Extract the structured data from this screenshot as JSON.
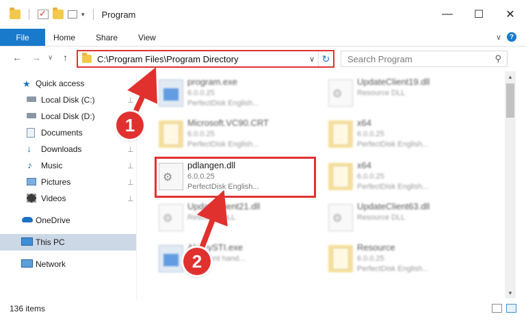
{
  "window": {
    "title": "Program",
    "minimize": "—",
    "maximize": "☐",
    "close": "✕"
  },
  "ribbon": {
    "tabs": [
      "File",
      "Home",
      "Share",
      "View"
    ],
    "expand": "∨",
    "help": "?"
  },
  "nav": {
    "back": "←",
    "forward": "→",
    "recent": "∨",
    "up": "↑",
    "address": "C:\\Program Files\\Program Directory",
    "address_dropdown": "∨",
    "refresh": "↻",
    "search_placeholder": "Search Program"
  },
  "sidebar": {
    "items": [
      {
        "label": "Quick access",
        "icon": "star-icon"
      },
      {
        "label": "Local Disk (C:)",
        "icon": "drive-icon",
        "pinned": true
      },
      {
        "label": "Local Disk (D:)",
        "icon": "drive-icon",
        "pinned": true
      },
      {
        "label": "Documents",
        "icon": "documents-icon",
        "pinned": true
      },
      {
        "label": "Downloads",
        "icon": "download-icon",
        "pinned": true
      },
      {
        "label": "Music",
        "icon": "music-icon",
        "pinned": true
      },
      {
        "label": "Pictures",
        "icon": "pictures-icon",
        "pinned": true
      },
      {
        "label": "Videos",
        "icon": "videos-icon",
        "pinned": true
      },
      {
        "label": "OneDrive",
        "icon": "cloud-icon"
      },
      {
        "label": "This PC",
        "icon": "computer-icon",
        "selected": true
      },
      {
        "label": "Network",
        "icon": "network-icon"
      }
    ],
    "pin_glyph": "📌"
  },
  "files": [
    {
      "name": "program.exe",
      "version": "6.0.0.25",
      "desc": "PerfectDisk English...",
      "type": "exe"
    },
    {
      "name": "UpdateClient19.dll",
      "version": "",
      "desc": "Resource DLL",
      "type": "dll"
    },
    {
      "name": "Microsoft.VC90.CRT",
      "version": "6.0.0.25",
      "desc": "PerfectDisk English...",
      "type": "folder"
    },
    {
      "name": "x64",
      "version": "6.0.0.25",
      "desc": "PerfectDisk English...",
      "type": "folder"
    },
    {
      "name": "pdlangen.dll",
      "version": "6.0.0.25",
      "desc": "PerfectDisk English...",
      "type": "dll",
      "highlighted": true
    },
    {
      "name": "x64",
      "version": "6.0.0.25",
      "desc": "PerfectDisk English...",
      "type": "folder"
    },
    {
      "name": "UpdateClient21.dll",
      "version": "",
      "desc": "Resource DLL",
      "type": "dll"
    },
    {
      "name": "UpdateClient63.dll",
      "version": "",
      "desc": "Resource DLL",
      "type": "dll"
    },
    {
      "name": "AbbyySTI.exe",
      "version": "",
      "desc": "...st event hand...",
      "type": "exe"
    },
    {
      "name": "Resource",
      "version": "6.0.0.25",
      "desc": "PerfectDisk English...",
      "type": "folder"
    }
  ],
  "annotations": {
    "step1": "1",
    "step2": "2",
    "color": "#e0312f"
  },
  "status": {
    "count": "136 items"
  }
}
